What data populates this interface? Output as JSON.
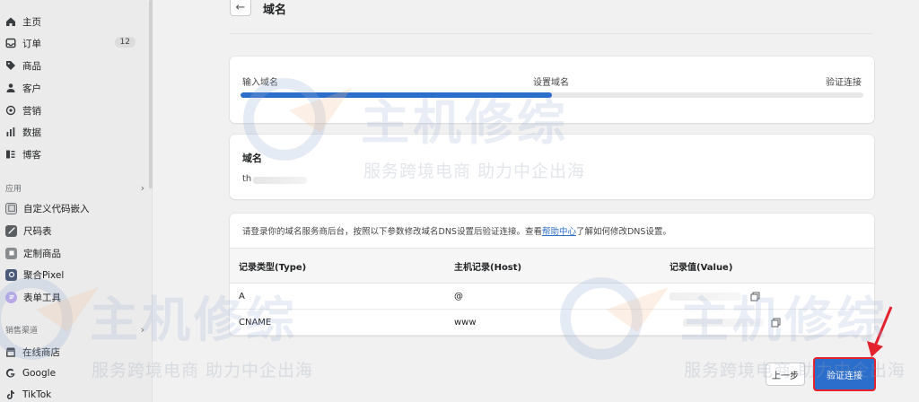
{
  "sidebar": {
    "main_items": [
      {
        "label": "主页",
        "icon": "home-icon"
      },
      {
        "label": "订单",
        "icon": "inbox-icon",
        "badge": "12"
      },
      {
        "label": "商品",
        "icon": "tag-icon"
      },
      {
        "label": "客户",
        "icon": "person-icon"
      },
      {
        "label": "营销",
        "icon": "target-icon"
      },
      {
        "label": "数据",
        "icon": "bar-chart-icon"
      },
      {
        "label": "博客",
        "icon": "blog-icon"
      }
    ],
    "apps_label": "应用",
    "app_items": [
      {
        "label": "自定义代码嵌入",
        "icon": "code-embed-icon",
        "color": "#6d7175"
      },
      {
        "label": "尺码表",
        "icon": "ruler-icon",
        "color": "#5c5f62"
      },
      {
        "label": "定制商品",
        "icon": "custom-product-icon",
        "color": "#8a8d90"
      },
      {
        "label": "聚合Pixel",
        "icon": "pixel-icon",
        "color": "#4a5a78"
      },
      {
        "label": "表单工具",
        "icon": "form-icon",
        "color": "#8a6fd1"
      }
    ],
    "channels_label": "销售渠道",
    "channel_items": [
      {
        "label": "在线商店",
        "icon": "store-icon"
      },
      {
        "label": "Google",
        "icon": "google-icon"
      },
      {
        "label": "TikTok",
        "icon": "tiktok-icon"
      }
    ]
  },
  "header": {
    "back_symbol": "←",
    "title": "域名"
  },
  "steps": {
    "items": [
      "输入域名",
      "设置域名",
      "验证连接"
    ],
    "progress_fraction": 0.5
  },
  "domain": {
    "heading": "域名",
    "value": "th"
  },
  "dns": {
    "info_prefix": "请登录你的域名服务商后台，按照以下参数修改域名DNS设置后验证连接。查看",
    "info_link": "帮助中心",
    "info_suffix": "了解如何修改DNS设置。",
    "columns": [
      "记录类型(Type)",
      "主机记录(Host)",
      "记录值(Value)"
    ],
    "rows": [
      {
        "type": "A",
        "host": "@"
      },
      {
        "type": "CNAME",
        "host": "www"
      }
    ]
  },
  "footer": {
    "prev_label": "上一步",
    "verify_label": "验证连接"
  },
  "watermark": {
    "big": "主机修综",
    "small": "服务跨境电商  助力中企出海"
  },
  "colors": {
    "accent": "#2c6ecb",
    "highlight": "#e3232d"
  }
}
